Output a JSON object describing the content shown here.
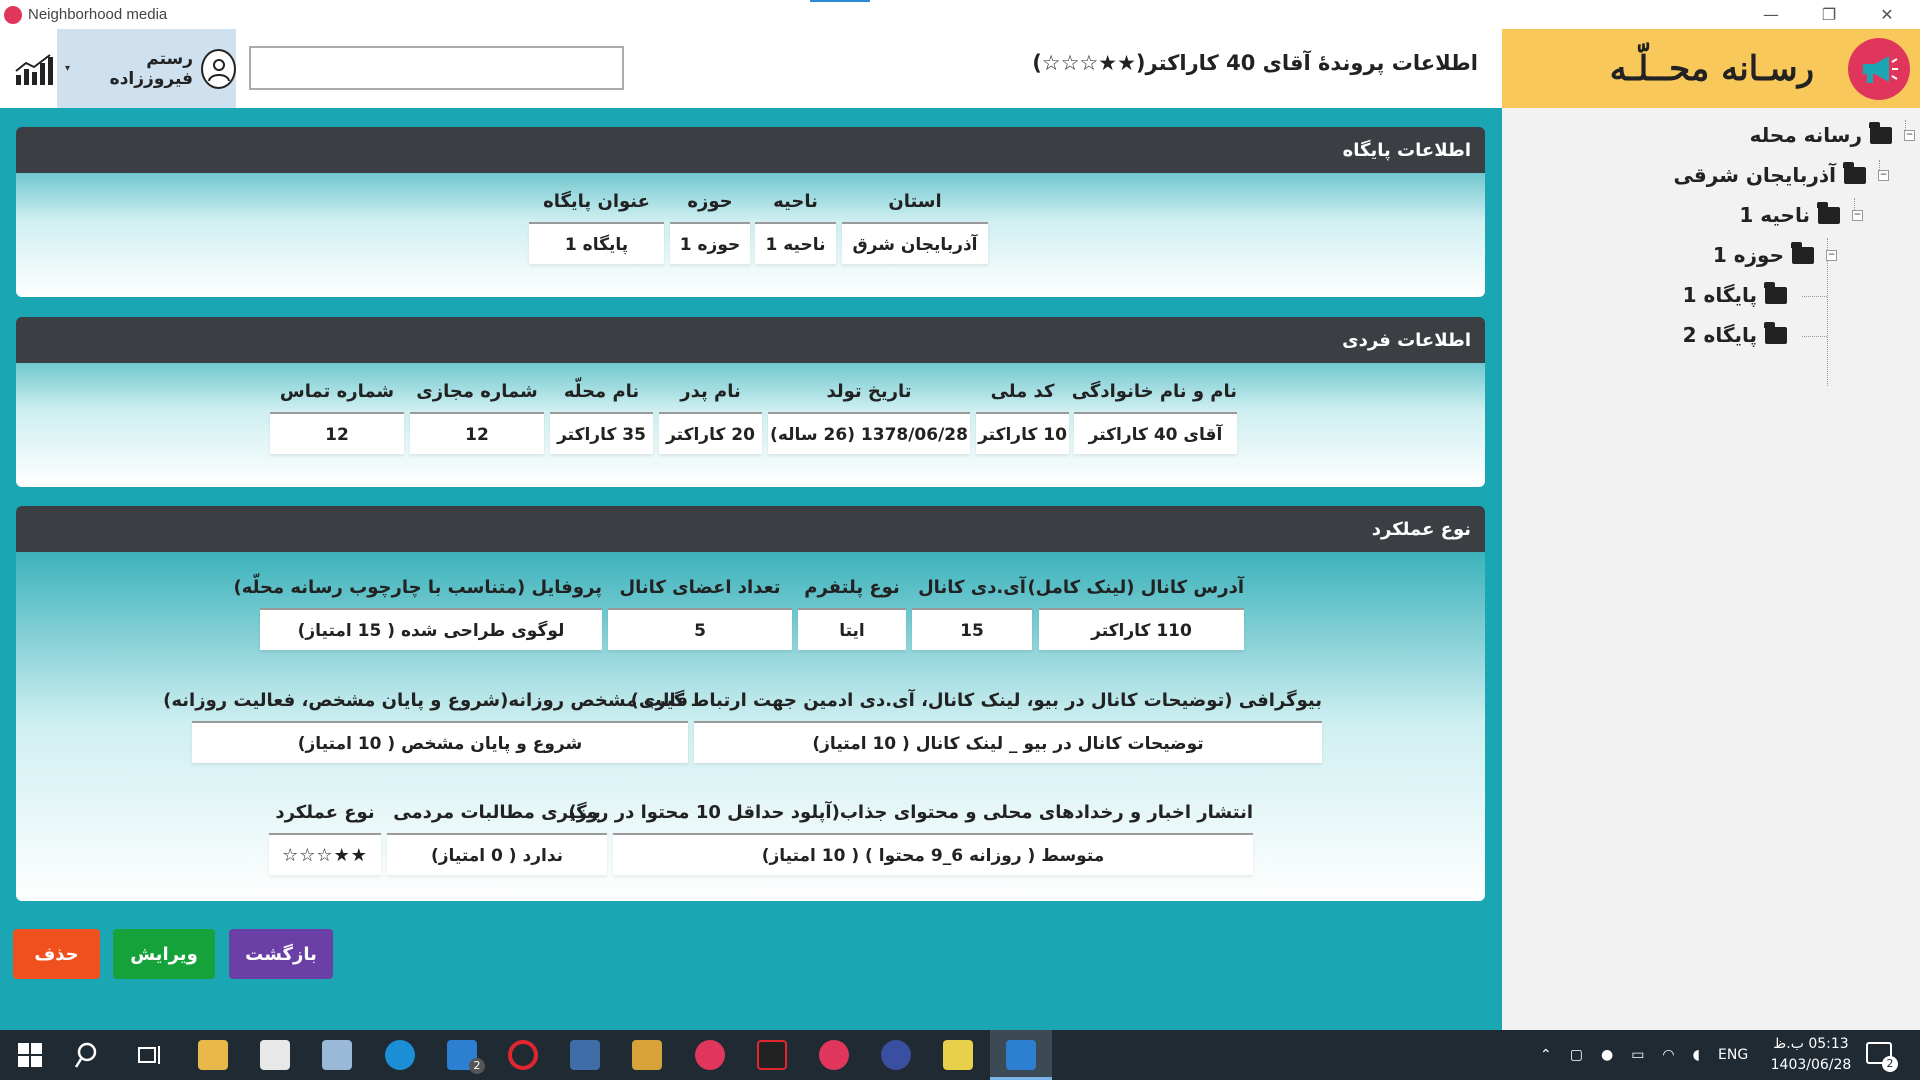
{
  "window": {
    "title": "Neighborhood media",
    "minimize": "—",
    "restore": "❐",
    "close": "✕"
  },
  "header": {
    "page_title": "اطلاعات پروندۀ آقای 40 کاراکتر(★★☆☆☆)",
    "user_name": "رستم فیروززاده",
    "search_value": "",
    "brand_name": "رسـانه محــلّـه"
  },
  "tree": {
    "root": "رسانه محله",
    "province": "آذربایجان شرقی",
    "district": "ناحیه 1",
    "zone": "حوزه 1",
    "base1": "پایگاه 1",
    "base2": "پایگاه 2"
  },
  "base_info": {
    "heading": "اطلاعات پایگاه",
    "fields": [
      {
        "label": "استان",
        "value": "آذربایجان شرق"
      },
      {
        "label": "ناحیه",
        "value": "ناحیه 1"
      },
      {
        "label": "حوزه",
        "value": "حوزه 1"
      },
      {
        "label": "عنوان پایگاه",
        "value": "پایگاه 1"
      }
    ]
  },
  "personal_info": {
    "heading": "اطلاعات فردی",
    "fields": [
      {
        "label": "نام و نام خانوادگی",
        "value": "آقای 40 کاراکتر"
      },
      {
        "label": "کد ملی",
        "value": "10 کاراکتر"
      },
      {
        "label": "تاریخ تولد",
        "value": "1378/06/28 (26 ساله)"
      },
      {
        "label": "نام پدر",
        "value": "20 کاراکتر"
      },
      {
        "label": "نام محلّه",
        "value": "35 کاراکتر"
      },
      {
        "label": "شماره مجازی",
        "value": "12"
      },
      {
        "label": "شماره تماس",
        "value": "12"
      }
    ]
  },
  "performance": {
    "heading": "نوع عملکرد",
    "row1": [
      {
        "label": "آدرس کانال (لینک کامل)",
        "value": "110 کاراکتر"
      },
      {
        "label": "آی.دی کانال",
        "value": "15"
      },
      {
        "label": "نوع پلتفرم",
        "value": "ایتا"
      },
      {
        "label": "تعداد اعضای کانال",
        "value": "5"
      },
      {
        "label": "پروفایل (متناسب با چارچوب رسانه محلّه)",
        "value": "لوگوی طراحی شده ( 15 امتیاز)"
      }
    ],
    "row2": [
      {
        "label": "بیوگرافی (توضیحات کانال در بیو، لینک کانال، آی.دی ادمین جهت ارتباط گیری)",
        "value": "توضیحات کانال در بیو _ لینک کانال ( 10 امتیاز)"
      },
      {
        "label": "قالب مشخص روزانه(شروع و پایان مشخص، فعالیت روزانه)",
        "value": "شروع و پایان مشخص ( 10 امتیاز)"
      }
    ],
    "row3": [
      {
        "label": "انتشار اخبار و رخدادهای محلی و محتوای جذاب(آپلود حداقل 10 محتوا در روز)",
        "value": "متوسط ( روزانه  6_9 محتوا ) ( 10 امتیاز)"
      },
      {
        "label": "پیگیری مطالبات مردمی",
        "value": "ندارد ( 0 امتیاز)"
      },
      {
        "label": "نوع عملکرد",
        "value": "★★☆☆☆",
        "rating": 2
      }
    ]
  },
  "actions": {
    "back": "بازگشت",
    "edit": "ویرایش",
    "delete": "حذف"
  },
  "colors": {
    "delete": "#f0501e",
    "edit": "#16a23a",
    "back": "#6a3fa6",
    "brand_bg": "#f8c85b",
    "content_bg": "#1aa7b3",
    "section_head": "#3b3f44"
  },
  "taskbar": {
    "badge_mail": "2",
    "lang": "ENG",
    "time": "05:13 ب.ظ",
    "date": "1403/06/28",
    "notif_count": "2"
  }
}
